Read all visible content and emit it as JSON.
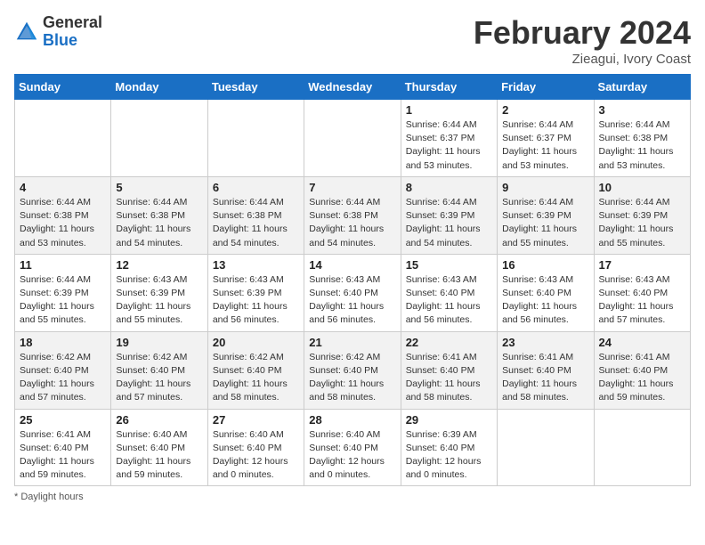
{
  "header": {
    "logo_general": "General",
    "logo_blue": "Blue",
    "month_title": "February 2024",
    "location": "Zieagui, Ivory Coast"
  },
  "weekdays": [
    "Sunday",
    "Monday",
    "Tuesday",
    "Wednesday",
    "Thursday",
    "Friday",
    "Saturday"
  ],
  "footer": {
    "note": "Daylight hours"
  },
  "weeks": [
    {
      "days": [
        {
          "num": "",
          "info": ""
        },
        {
          "num": "",
          "info": ""
        },
        {
          "num": "",
          "info": ""
        },
        {
          "num": "",
          "info": ""
        },
        {
          "num": "1",
          "info": "Sunrise: 6:44 AM\nSunset: 6:37 PM\nDaylight: 11 hours\nand 53 minutes."
        },
        {
          "num": "2",
          "info": "Sunrise: 6:44 AM\nSunset: 6:37 PM\nDaylight: 11 hours\nand 53 minutes."
        },
        {
          "num": "3",
          "info": "Sunrise: 6:44 AM\nSunset: 6:38 PM\nDaylight: 11 hours\nand 53 minutes."
        }
      ]
    },
    {
      "days": [
        {
          "num": "4",
          "info": "Sunrise: 6:44 AM\nSunset: 6:38 PM\nDaylight: 11 hours\nand 53 minutes."
        },
        {
          "num": "5",
          "info": "Sunrise: 6:44 AM\nSunset: 6:38 PM\nDaylight: 11 hours\nand 54 minutes."
        },
        {
          "num": "6",
          "info": "Sunrise: 6:44 AM\nSunset: 6:38 PM\nDaylight: 11 hours\nand 54 minutes."
        },
        {
          "num": "7",
          "info": "Sunrise: 6:44 AM\nSunset: 6:38 PM\nDaylight: 11 hours\nand 54 minutes."
        },
        {
          "num": "8",
          "info": "Sunrise: 6:44 AM\nSunset: 6:39 PM\nDaylight: 11 hours\nand 54 minutes."
        },
        {
          "num": "9",
          "info": "Sunrise: 6:44 AM\nSunset: 6:39 PM\nDaylight: 11 hours\nand 55 minutes."
        },
        {
          "num": "10",
          "info": "Sunrise: 6:44 AM\nSunset: 6:39 PM\nDaylight: 11 hours\nand 55 minutes."
        }
      ]
    },
    {
      "days": [
        {
          "num": "11",
          "info": "Sunrise: 6:44 AM\nSunset: 6:39 PM\nDaylight: 11 hours\nand 55 minutes."
        },
        {
          "num": "12",
          "info": "Sunrise: 6:43 AM\nSunset: 6:39 PM\nDaylight: 11 hours\nand 55 minutes."
        },
        {
          "num": "13",
          "info": "Sunrise: 6:43 AM\nSunset: 6:39 PM\nDaylight: 11 hours\nand 56 minutes."
        },
        {
          "num": "14",
          "info": "Sunrise: 6:43 AM\nSunset: 6:40 PM\nDaylight: 11 hours\nand 56 minutes."
        },
        {
          "num": "15",
          "info": "Sunrise: 6:43 AM\nSunset: 6:40 PM\nDaylight: 11 hours\nand 56 minutes."
        },
        {
          "num": "16",
          "info": "Sunrise: 6:43 AM\nSunset: 6:40 PM\nDaylight: 11 hours\nand 56 minutes."
        },
        {
          "num": "17",
          "info": "Sunrise: 6:43 AM\nSunset: 6:40 PM\nDaylight: 11 hours\nand 57 minutes."
        }
      ]
    },
    {
      "days": [
        {
          "num": "18",
          "info": "Sunrise: 6:42 AM\nSunset: 6:40 PM\nDaylight: 11 hours\nand 57 minutes."
        },
        {
          "num": "19",
          "info": "Sunrise: 6:42 AM\nSunset: 6:40 PM\nDaylight: 11 hours\nand 57 minutes."
        },
        {
          "num": "20",
          "info": "Sunrise: 6:42 AM\nSunset: 6:40 PM\nDaylight: 11 hours\nand 58 minutes."
        },
        {
          "num": "21",
          "info": "Sunrise: 6:42 AM\nSunset: 6:40 PM\nDaylight: 11 hours\nand 58 minutes."
        },
        {
          "num": "22",
          "info": "Sunrise: 6:41 AM\nSunset: 6:40 PM\nDaylight: 11 hours\nand 58 minutes."
        },
        {
          "num": "23",
          "info": "Sunrise: 6:41 AM\nSunset: 6:40 PM\nDaylight: 11 hours\nand 58 minutes."
        },
        {
          "num": "24",
          "info": "Sunrise: 6:41 AM\nSunset: 6:40 PM\nDaylight: 11 hours\nand 59 minutes."
        }
      ]
    },
    {
      "days": [
        {
          "num": "25",
          "info": "Sunrise: 6:41 AM\nSunset: 6:40 PM\nDaylight: 11 hours\nand 59 minutes."
        },
        {
          "num": "26",
          "info": "Sunrise: 6:40 AM\nSunset: 6:40 PM\nDaylight: 11 hours\nand 59 minutes."
        },
        {
          "num": "27",
          "info": "Sunrise: 6:40 AM\nSunset: 6:40 PM\nDaylight: 12 hours\nand 0 minutes."
        },
        {
          "num": "28",
          "info": "Sunrise: 6:40 AM\nSunset: 6:40 PM\nDaylight: 12 hours\nand 0 minutes."
        },
        {
          "num": "29",
          "info": "Sunrise: 6:39 AM\nSunset: 6:40 PM\nDaylight: 12 hours\nand 0 minutes."
        },
        {
          "num": "",
          "info": ""
        },
        {
          "num": "",
          "info": ""
        }
      ]
    }
  ]
}
